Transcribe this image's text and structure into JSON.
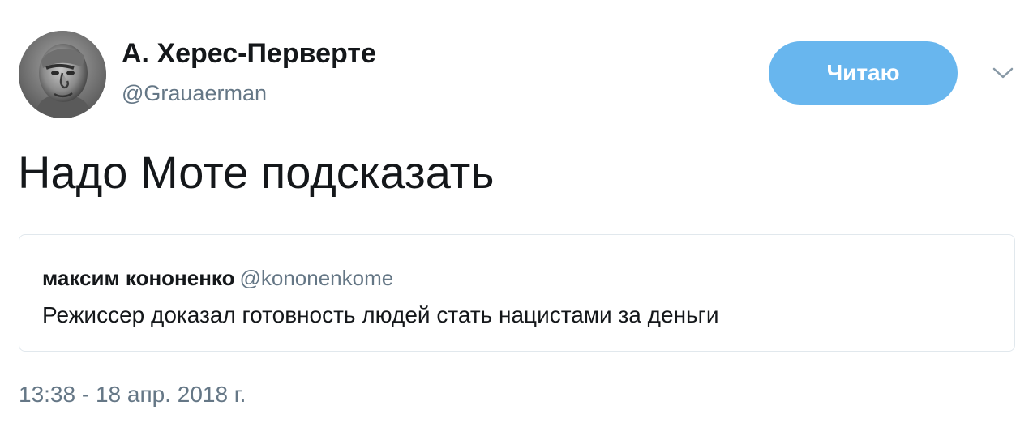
{
  "author": {
    "display_name": "А. Херес-Перверте",
    "handle": "@Grauaerman",
    "avatar_icon": "neanderthal-bust-avatar"
  },
  "follow_button": {
    "label": "Читаю",
    "color": "#68b6ee"
  },
  "menu": {
    "icon": "chevron-down-icon"
  },
  "tweet": {
    "text": "Надо Моте подсказать",
    "timestamp": "13:38 - 18 апр. 2018 г."
  },
  "quoted_tweet": {
    "author_name": "максим кононенко",
    "author_handle": "@kononenkome",
    "text": "Режиссер доказал готовность людей стать нацистами за деньги"
  },
  "colors": {
    "text_primary": "#14171a",
    "text_secondary": "#657786",
    "border": "#e1e8ed"
  }
}
